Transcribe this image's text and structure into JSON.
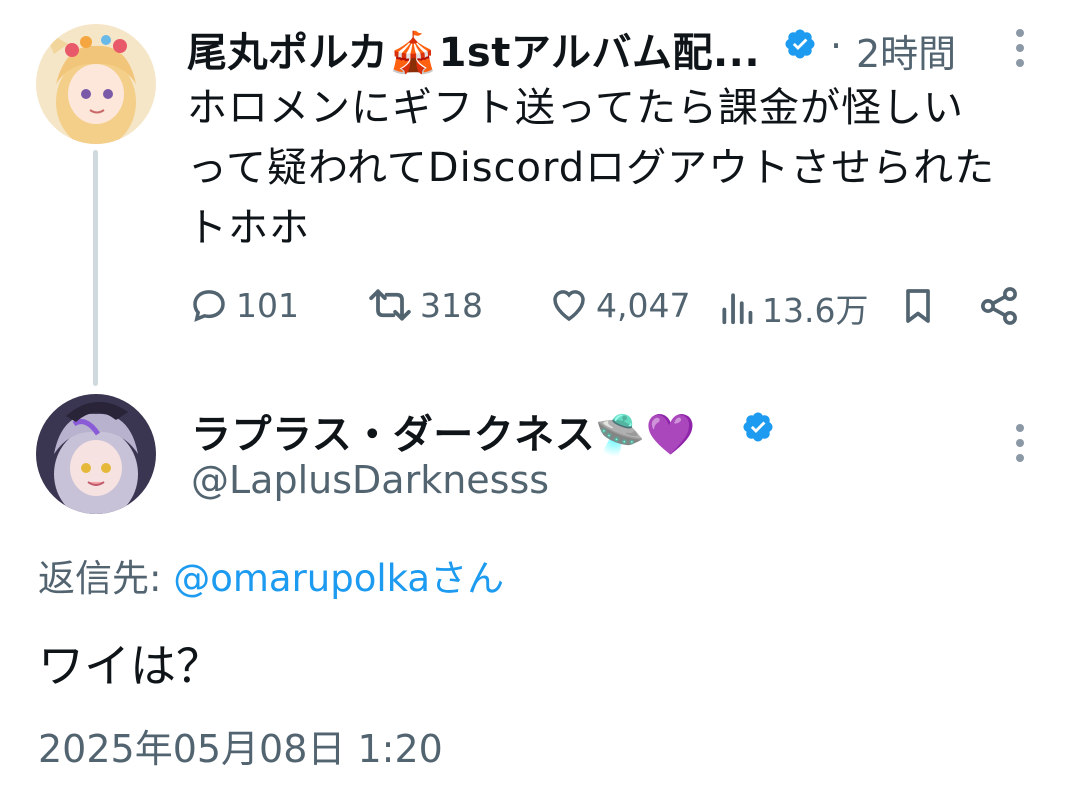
{
  "parent_tweet": {
    "author_name": "尾丸ポルカ🎪1stアルバム配...",
    "separator": "·",
    "time_ago": "2時間",
    "text": "ホロメンにギフト送ってたら課金が怪しいって疑われてDiscordログアウトさせられたトホホ",
    "text_lines": [
      "ホロメンにギフト送ってたら課金が怪しい",
      "って疑われてDiscordログアウトさせられた",
      "トホホ"
    ],
    "replies": "101",
    "retweets": "318",
    "likes": "4,047",
    "views": "13.6万"
  },
  "reply_tweet": {
    "author_name": "ラプラス・ダークネス🛸💜",
    "handle": "@LaplusDarknesss",
    "reply_to_label": "返信先: ",
    "reply_to_handle": "@omarupolka",
    "reply_to_suffix": "さん",
    "text": "ワイは？",
    "timestamp": "2025年05月08日 1:20"
  },
  "colors": {
    "text": "#0f1419",
    "muted": "#536471",
    "accent": "#1d9bf0",
    "thread_line": "#cfd9de"
  },
  "icons": [
    "verified-badge-icon",
    "more-icon",
    "reply-icon",
    "retweet-icon",
    "like-icon",
    "views-icon",
    "bookmark-icon",
    "share-icon"
  ]
}
